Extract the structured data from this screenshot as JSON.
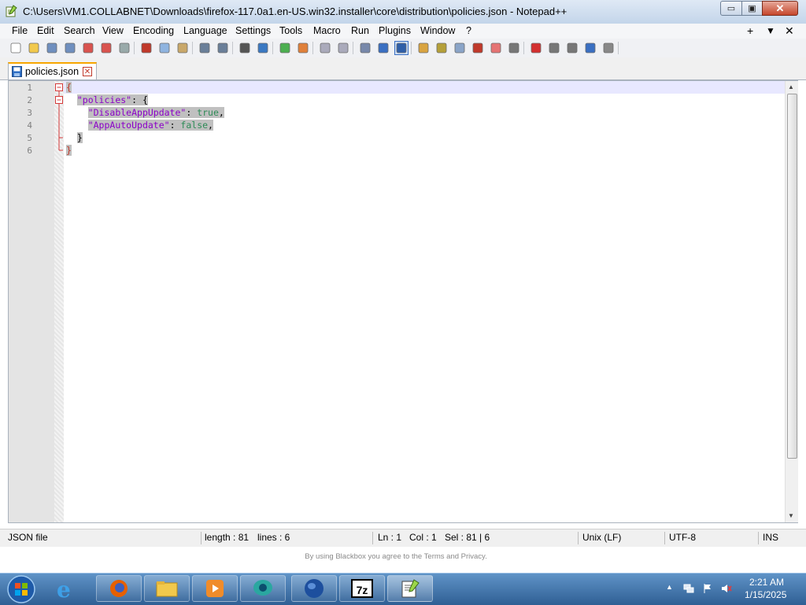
{
  "window": {
    "title": "C:\\Users\\VM1.COLLABNET\\Downloads\\firefox-117.0a1.en-US.win32.installer\\core\\distribution\\policies.json - Notepad++",
    "minimize_label": "▭",
    "maximize_label": "▣",
    "close_label": "✕"
  },
  "menu": {
    "items": [
      "File",
      "Edit",
      "Search",
      "View",
      "Encoding",
      "Language",
      "Settings",
      "Tools",
      "Macro",
      "Run",
      "Plugins",
      "Window",
      "?"
    ],
    "right_plus": "+",
    "right_arrow": "▼",
    "right_x": "✕"
  },
  "toolbar": {
    "icons": [
      "new-file-icon",
      "open-file-icon",
      "save-icon",
      "save-all-icon",
      "close-icon",
      "close-all-icon",
      "print-icon",
      "cut-icon",
      "copy-icon",
      "paste-icon",
      "undo-icon",
      "redo-icon",
      "find-icon",
      "replace-icon",
      "zoom-in-icon",
      "zoom-out-icon",
      "sync-vertical-icon",
      "sync-horizontal-icon",
      "word-wrap-icon",
      "show-all-chars-icon",
      "indent-guide-icon",
      "lang-icon",
      "map-icon",
      "doc-list-icon",
      "func-list-icon",
      "folder-workspace-icon",
      "monitor-icon",
      "record-macro-icon",
      "stop-macro-icon",
      "play-macro-icon",
      "run-macro-multiple-icon",
      "save-macro-icon"
    ]
  },
  "tabs": [
    {
      "label": "policies.json",
      "close": "✕"
    }
  ],
  "editor": {
    "line_numbers": [
      "1",
      "2",
      "3",
      "4",
      "5",
      "6"
    ],
    "lines": [
      {
        "indent": "",
        "parts": [
          {
            "t": "{",
            "c": "br"
          }
        ]
      },
      {
        "indent": "  ",
        "parts": [
          {
            "t": "\"policies\"",
            "c": "k"
          },
          {
            "t": ": {",
            "c": "p"
          }
        ]
      },
      {
        "indent": "    ",
        "parts": [
          {
            "t": "\"DisableAppUpdate\"",
            "c": "k"
          },
          {
            "t": ": ",
            "c": "p"
          },
          {
            "t": "true",
            "c": "v"
          },
          {
            "t": ",",
            "c": "p"
          }
        ]
      },
      {
        "indent": "    ",
        "parts": [
          {
            "t": "\"AppAutoUpdate\"",
            "c": "k"
          },
          {
            "t": ": ",
            "c": "p"
          },
          {
            "t": "false",
            "c": "v"
          },
          {
            "t": ",",
            "c": "p"
          }
        ]
      },
      {
        "indent": "  ",
        "parts": [
          {
            "t": "}",
            "c": "p"
          }
        ]
      },
      {
        "indent": "",
        "parts": [
          {
            "t": "}",
            "c": "br"
          }
        ]
      }
    ]
  },
  "status": {
    "file_type": "JSON file",
    "length": "length : 81",
    "lines": "lines : 6",
    "ln": "Ln : 1",
    "col": "Col : 1",
    "sel": "Sel : 81 | 6",
    "eol": "Unix (LF)",
    "encoding": "UTF-8",
    "mode": "INS"
  },
  "footnote": "By using Blackbox you agree to the Terms and Privacy.",
  "taskbar": {
    "apps": [
      "start-orb-icon",
      "internet-explorer-icon",
      "firefox-icon",
      "file-explorer-icon",
      "media-player-icon",
      "chat-app-icon",
      "globe-app-icon",
      "7zip-icon",
      "notepadpp-icon"
    ],
    "sevenzip_label": "7z",
    "clock_time": "2:21 AM",
    "clock_date": "1/15/2025"
  }
}
